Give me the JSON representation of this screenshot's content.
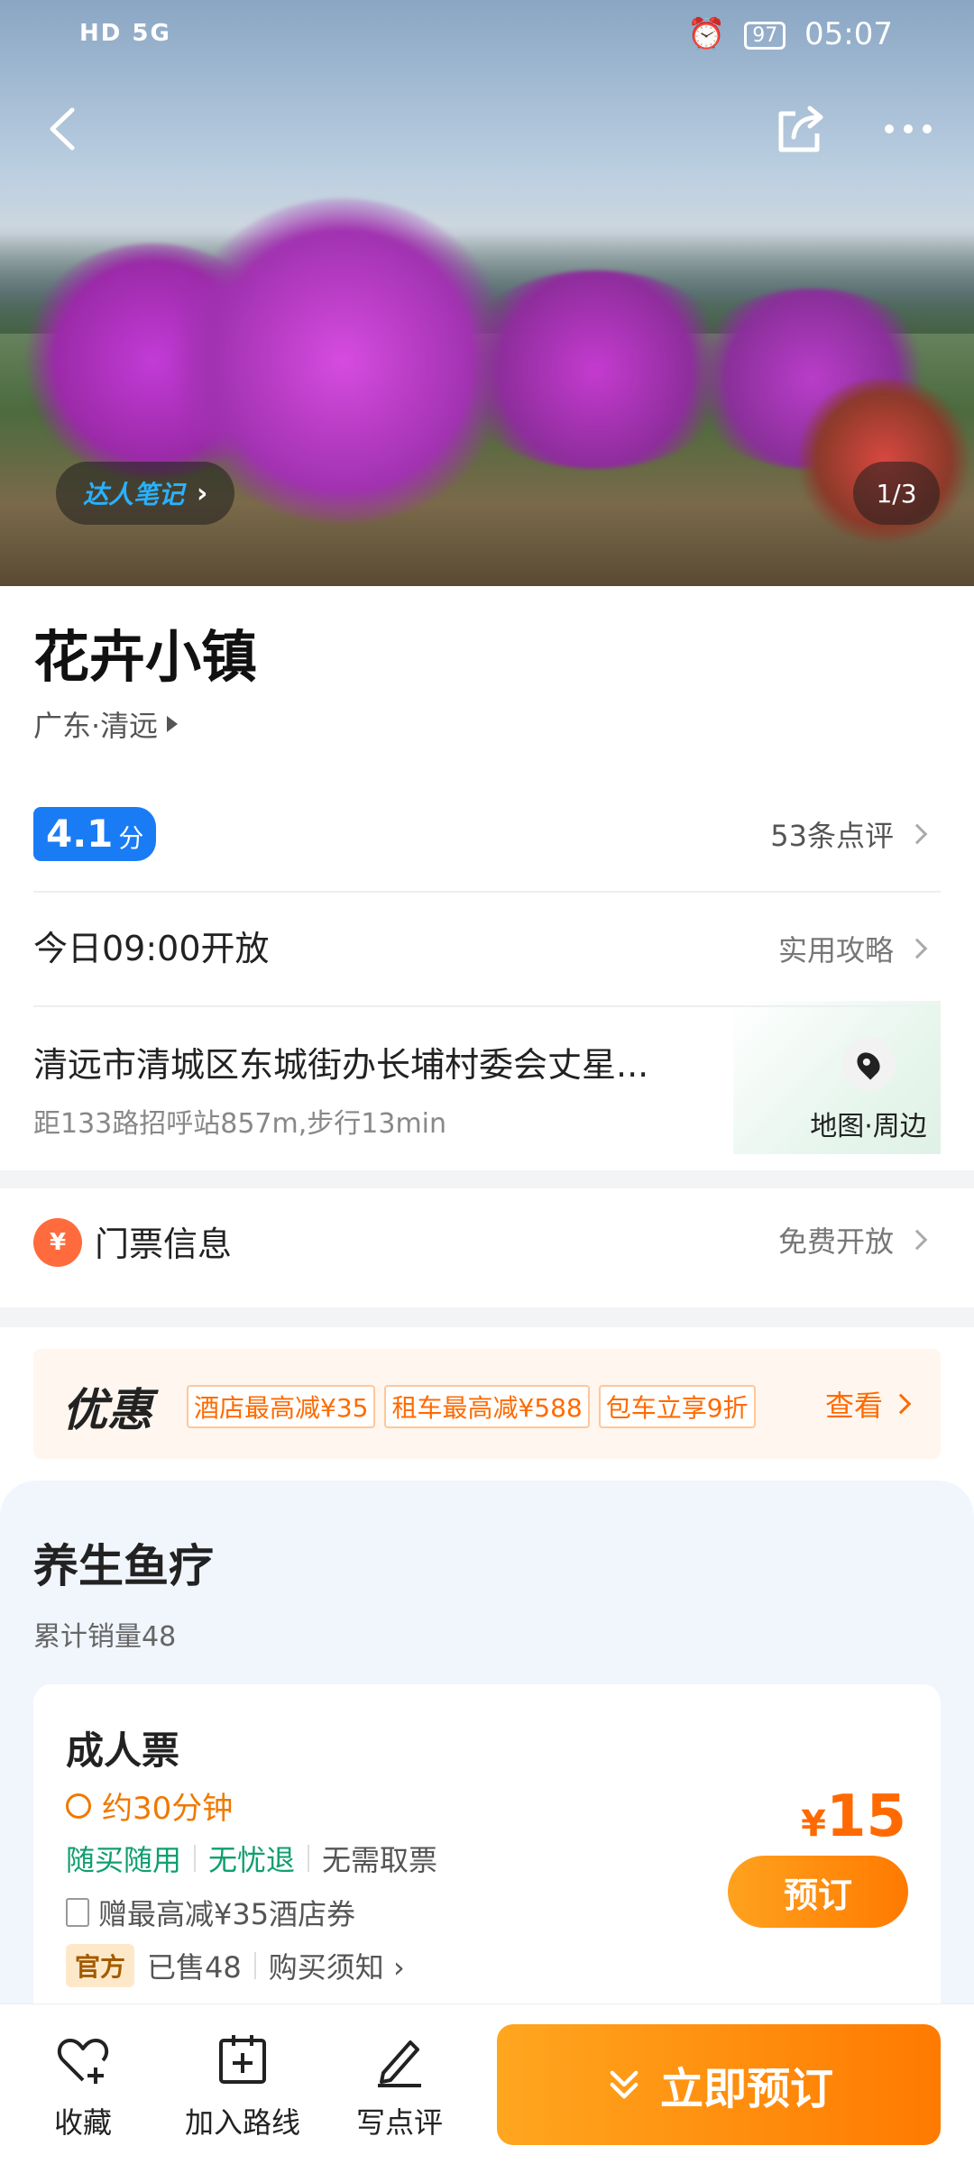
{
  "status_bar": {
    "network": "HD 5G",
    "battery": "97",
    "time": "05:07"
  },
  "hero": {
    "note_badge": "达人笔记",
    "image_counter": "1/3"
  },
  "attraction": {
    "title": "花卉小镇",
    "region": "广东·清远"
  },
  "rating": {
    "score": "4.1",
    "unit": "分",
    "reviews": "53条点评"
  },
  "hours": {
    "text": "今日09:00开放",
    "guide": "实用攻略"
  },
  "address": {
    "text": "清远市清城区东城街办长埔村委会丈星...",
    "distance": "距133路招呼站857m,步行13min",
    "map_label": "地图·周边"
  },
  "ticket_info": {
    "icon_text": "¥",
    "label": "门票信息",
    "status": "免费开放"
  },
  "promo": {
    "heading": "优惠",
    "tags": [
      "酒店最高减¥35",
      "租车最高减¥588",
      "包车立享9折"
    ],
    "see": "查看"
  },
  "product": {
    "title": "养生鱼疗",
    "sales": "累计销量48",
    "card": {
      "name": "成人票",
      "duration": "约30分钟",
      "features_green": [
        "随买随用",
        "无忧退"
      ],
      "feature_plain": "无需取票",
      "gift": "赠最高减¥35酒店券",
      "official": "官方",
      "sold": "已售48",
      "notice": "购买须知",
      "currency": "¥",
      "price": "15",
      "book": "预订"
    }
  },
  "bottom_bar": {
    "favorite": "收藏",
    "add_route": "加入路线",
    "write_review": "写点评",
    "book_now": "立即预订"
  },
  "colors": {
    "accent_orange": "#ff7a00",
    "score_blue": "#1a7cf5",
    "green": "#0f9f6e"
  }
}
